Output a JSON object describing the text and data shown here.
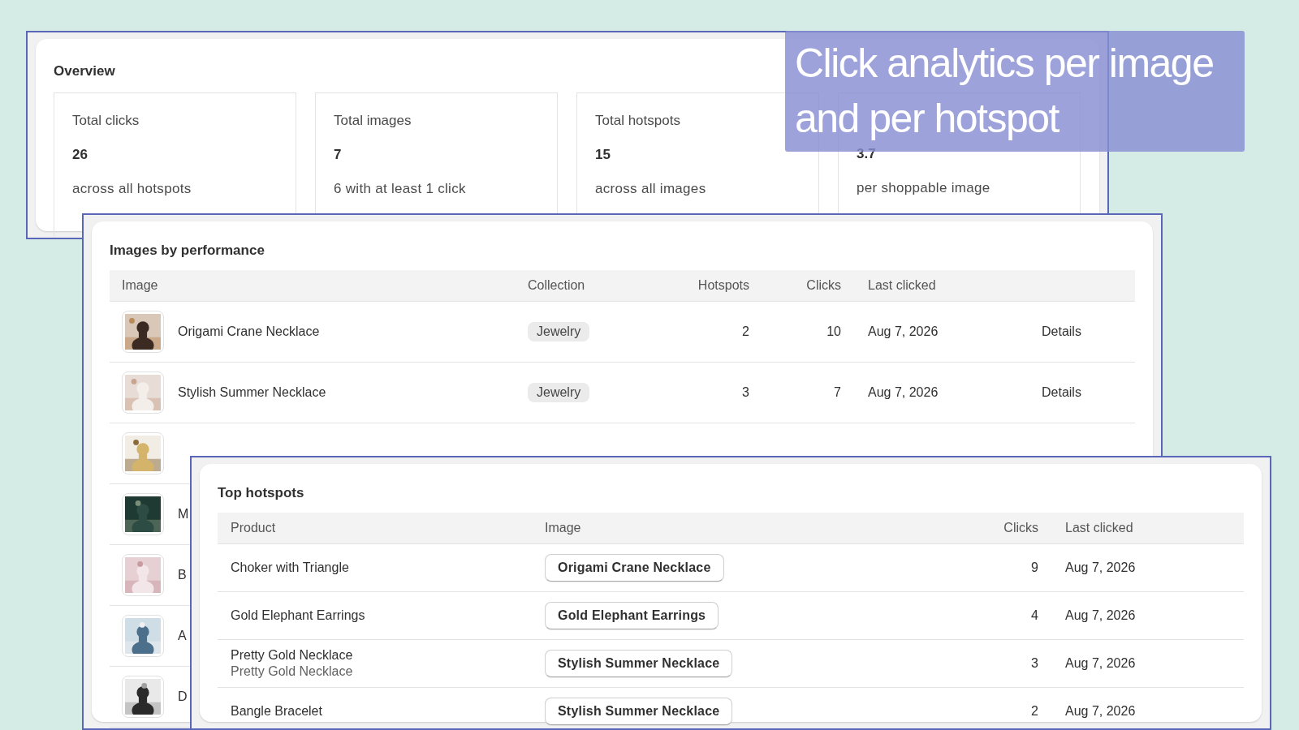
{
  "caption": {
    "lines": [
      "Click analytics per image",
      "and per hotspot"
    ]
  },
  "overview": {
    "title": "Overview",
    "stats": [
      {
        "label": "Total clicks",
        "value": "26",
        "note": "across all hotspots"
      },
      {
        "label": "Total images",
        "value": "7",
        "note": "6 with at least 1 click"
      },
      {
        "label": "Total hotspots",
        "value": "15",
        "note": "across all images"
      },
      {
        "value": "3.7",
        "note": "per shoppable image"
      }
    ]
  },
  "images_by_performance": {
    "title": "Images by performance",
    "columns": [
      "Image",
      "Collection",
      "Hotspots",
      "Clicks",
      "Last clicked"
    ],
    "rows": [
      {
        "image": {
          "kind": "picture"
        },
        "name": "Origami Crane Necklace",
        "collection": "Jewelry",
        "hotspots": "2",
        "clicks": "10",
        "last_clicked": "Aug 7, 2026",
        "action": "Details"
      },
      {
        "image": {
          "kind": "picture"
        },
        "name": "Stylish Summer Necklace",
        "collection": "Jewelry",
        "hotspots": "3",
        "clicks": "7",
        "last_clicked": "Aug 7, 2026",
        "action": "Details"
      },
      {
        "image": {
          "kind": "picture"
        }
      },
      {
        "image": {
          "kind": "picture"
        },
        "name": "M"
      },
      {
        "image": {
          "kind": "picture"
        },
        "name": "B"
      },
      {
        "image": {
          "kind": "picture"
        },
        "name": "A"
      },
      {
        "image": {
          "kind": "picture"
        },
        "name": "D"
      }
    ]
  },
  "top_hotspots": {
    "title": "Top hotspots",
    "columns": [
      "Product",
      "Image",
      "Clicks",
      "Last clicked"
    ],
    "rows": [
      {
        "product": "Choker with Triangle",
        "image": "Origami Crane Necklace",
        "clicks": "9",
        "last_clicked": "Aug 7, 2026"
      },
      {
        "product": "Gold Elephant Earrings",
        "image": "Gold Elephant Earrings",
        "clicks": "4",
        "last_clicked": "Aug 7, 2026"
      },
      {
        "product": "Pretty Gold Necklace",
        "variant": "Pretty Gold Necklace",
        "image": "Stylish Summer Necklace",
        "clicks": "3",
        "last_clicked": "Aug 7, 2026"
      },
      {
        "product": "Bangle Bracelet",
        "image": "Stylish Summer Necklace",
        "clicks": "2",
        "last_clicked": "Aug 7, 2026"
      }
    ]
  }
}
